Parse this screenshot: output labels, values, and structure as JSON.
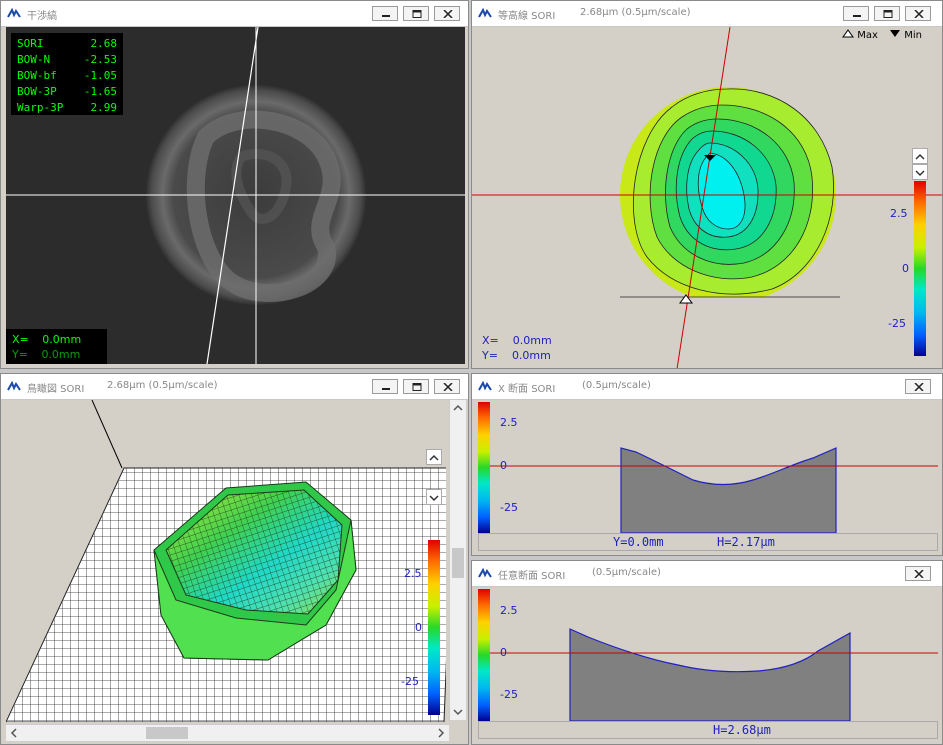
{
  "windows": {
    "interference": {
      "title": "干渉縞",
      "readings": [
        {
          "label": "SORI",
          "value": "2.68"
        },
        {
          "label": "BOW-N",
          "value": "-2.53"
        },
        {
          "label": "BOW-bf",
          "value": "-1.05"
        },
        {
          "label": "BOW-3P",
          "value": "-1.65"
        },
        {
          "label": "Warp-3P",
          "value": "2.99"
        }
      ],
      "x_label": "X=",
      "x_value": "0.0mm",
      "y_label": "Y=",
      "y_value": "0.0mm"
    },
    "contour": {
      "title": "等高線 SORI",
      "subtitle": "2.68µm (0.5µm/scale)",
      "legend_max": "Max",
      "legend_min": "Min",
      "scale_ticks": [
        "2.5",
        "0",
        "-25"
      ],
      "x_label": "X=",
      "x_value": "0.0mm",
      "y_label": "Y=",
      "y_value": "0.0mm"
    },
    "birdseye": {
      "title": "鳥瞰図 SORI",
      "subtitle": "2.68µm (0.5µm/scale)",
      "scale_ticks": [
        "2.5",
        "0",
        "-25"
      ]
    },
    "x_section": {
      "title": "X 断面 SORI",
      "subtitle": "(0.5µm/scale)",
      "scale_ticks": [
        "2.5",
        "0",
        "-25"
      ],
      "footer_y": "Y=0.0mm",
      "footer_h": "H=2.17µm"
    },
    "any_section": {
      "title": "任意断面 SORI",
      "subtitle": "(0.5µm/scale)",
      "scale_ticks": [
        "2.5",
        "0",
        "-25"
      ],
      "footer_h": "H=2.68µm"
    }
  },
  "colors": {
    "readout_text": "#00ff00",
    "crosshair": "#cc0000",
    "scale_label": "#2020c0"
  }
}
